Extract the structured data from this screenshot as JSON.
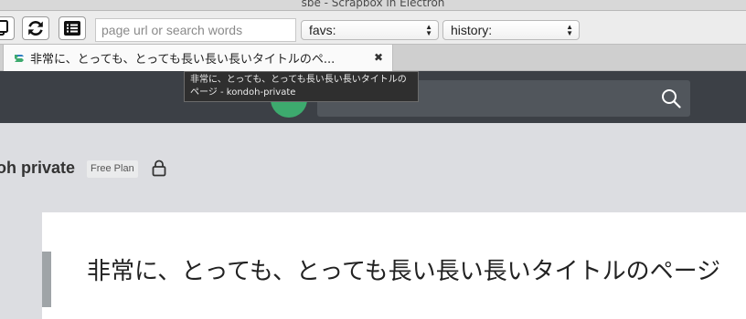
{
  "window": {
    "title": "sbe - Scrapbox in Electron"
  },
  "toolbar": {
    "url_placeholder": "page url or search words",
    "favs_label": "favs:",
    "history_label": "history:"
  },
  "tab": {
    "title": "非常に、とっても、とっても長い長い長いタイトルのペ...",
    "close_glyph": "✖",
    "tooltip_line1": "非常に、とっても、とっても長い長い長いタイトルの",
    "tooltip_line2": "ページ - kondoh-private"
  },
  "project": {
    "name": "oh private",
    "plan": "Free Plan"
  },
  "page": {
    "title": "非常に、とっても、とっても長い長い長いタイトルのページ"
  },
  "icons": {
    "copy": "copy-icon",
    "reload": "reload-icon",
    "list": "list-icon",
    "search": "search-icon",
    "lock": "lock-icon"
  },
  "colors": {
    "header_bg": "#3c4046",
    "logo_green": "#3daa6e",
    "search_bg": "#51565c",
    "page_bg": "#dcdde1"
  }
}
